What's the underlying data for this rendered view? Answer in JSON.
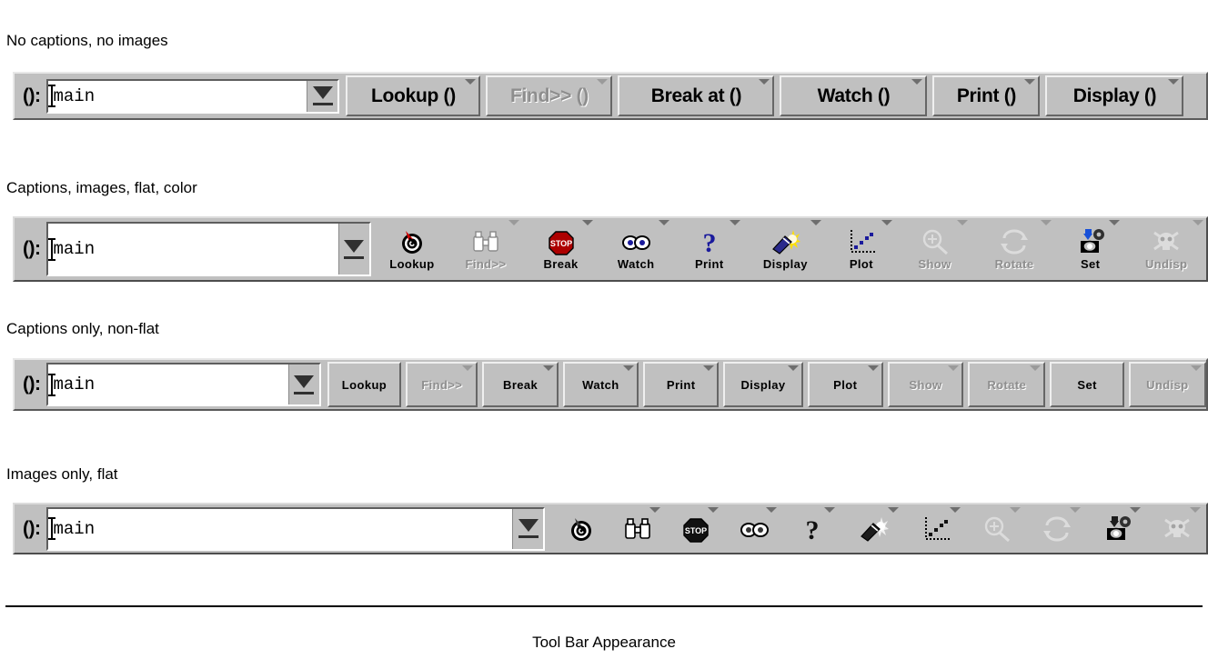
{
  "figure_caption": "Tool Bar Appearance",
  "combo": {
    "prompt": "():",
    "value": "main",
    "placeholder": "main",
    "arrow_icon": "chevron-down-icon"
  },
  "sections": [
    {
      "id": "no-captions-no-images",
      "label": "No captions, no images",
      "style": {
        "captions": true,
        "images": false,
        "flat": false,
        "color": false,
        "large_text": true
      },
      "buttons": [
        {
          "label": "Lookup ()",
          "icon": "target-icon",
          "enabled": true,
          "dropdown": true
        },
        {
          "label": "Find>> ()",
          "icon": "binoculars-icon",
          "enabled": false,
          "dropdown": true
        },
        {
          "label": "Break at ()",
          "icon": "stop-sign-icon",
          "enabled": true,
          "dropdown": true
        },
        {
          "label": "Watch ()",
          "icon": "eyes-icon",
          "enabled": true,
          "dropdown": true
        },
        {
          "label": "Print ()",
          "icon": "question-icon",
          "enabled": true,
          "dropdown": true
        },
        {
          "label": "Display ()",
          "icon": "flashlight-icon",
          "enabled": true,
          "dropdown": true
        }
      ]
    },
    {
      "id": "captions-images-flat-color",
      "label": "Captions, images, flat, color",
      "style": {
        "captions": true,
        "images": true,
        "flat": true,
        "color": true
      },
      "buttons": [
        {
          "label": "Lookup",
          "icon": "target-icon",
          "enabled": true,
          "dropdown": false
        },
        {
          "label": "Find>>",
          "icon": "binoculars-icon",
          "enabled": false,
          "dropdown": true
        },
        {
          "label": "Break",
          "icon": "stop-sign-icon",
          "enabled": true,
          "dropdown": true
        },
        {
          "label": "Watch",
          "icon": "eyes-icon",
          "enabled": true,
          "dropdown": true
        },
        {
          "label": "Print",
          "icon": "question-icon",
          "enabled": true,
          "dropdown": true
        },
        {
          "label": "Display",
          "icon": "flashlight-icon",
          "enabled": true,
          "dropdown": true
        },
        {
          "label": "Plot",
          "icon": "scatter-plot-icon",
          "enabled": true,
          "dropdown": true
        },
        {
          "label": "Show",
          "icon": "magnifier-icon",
          "enabled": false,
          "dropdown": true
        },
        {
          "label": "Rotate",
          "icon": "rotate-icon",
          "enabled": false,
          "dropdown": true
        },
        {
          "label": "Set",
          "icon": "gears-icon",
          "enabled": true,
          "dropdown": true
        },
        {
          "label": "Undisp",
          "icon": "skull-icon",
          "enabled": false,
          "dropdown": true
        }
      ]
    },
    {
      "id": "captions-only-non-flat",
      "label": "Captions only, non-flat",
      "style": {
        "captions": true,
        "images": false,
        "flat": false,
        "color": false
      },
      "buttons": [
        {
          "label": "Lookup",
          "icon": "target-icon",
          "enabled": true,
          "dropdown": false
        },
        {
          "label": "Find>>",
          "icon": "binoculars-icon",
          "enabled": false,
          "dropdown": true
        },
        {
          "label": "Break",
          "icon": "stop-sign-icon",
          "enabled": true,
          "dropdown": true
        },
        {
          "label": "Watch",
          "icon": "eyes-icon",
          "enabled": true,
          "dropdown": true
        },
        {
          "label": "Print",
          "icon": "question-icon",
          "enabled": true,
          "dropdown": true
        },
        {
          "label": "Display",
          "icon": "flashlight-icon",
          "enabled": true,
          "dropdown": true
        },
        {
          "label": "Plot",
          "icon": "scatter-plot-icon",
          "enabled": true,
          "dropdown": true
        },
        {
          "label": "Show",
          "icon": "magnifier-icon",
          "enabled": false,
          "dropdown": true
        },
        {
          "label": "Rotate",
          "icon": "rotate-icon",
          "enabled": false,
          "dropdown": true
        },
        {
          "label": "Set",
          "icon": "gears-icon",
          "enabled": true,
          "dropdown": false
        },
        {
          "label": "Undisp",
          "icon": "skull-icon",
          "enabled": false,
          "dropdown": true
        }
      ]
    },
    {
      "id": "images-only-flat",
      "label": "Images only, flat",
      "style": {
        "captions": false,
        "images": true,
        "flat": true,
        "color": false
      },
      "buttons": [
        {
          "label": "Lookup",
          "icon": "target-icon",
          "enabled": true,
          "dropdown": false
        },
        {
          "label": "Find>>",
          "icon": "binoculars-icon",
          "enabled": true,
          "dropdown": true
        },
        {
          "label": "Break",
          "icon": "stop-sign-icon",
          "enabled": true,
          "dropdown": true
        },
        {
          "label": "Watch",
          "icon": "eyes-icon",
          "enabled": true,
          "dropdown": true
        },
        {
          "label": "Print",
          "icon": "question-icon",
          "enabled": true,
          "dropdown": true
        },
        {
          "label": "Display",
          "icon": "flashlight-icon",
          "enabled": true,
          "dropdown": true
        },
        {
          "label": "Plot",
          "icon": "scatter-plot-icon",
          "enabled": true,
          "dropdown": true
        },
        {
          "label": "Show",
          "icon": "magnifier-icon",
          "enabled": false,
          "dropdown": true
        },
        {
          "label": "Rotate",
          "icon": "rotate-icon",
          "enabled": false,
          "dropdown": true
        },
        {
          "label": "Set",
          "icon": "gears-icon",
          "enabled": true,
          "dropdown": true
        },
        {
          "label": "Undisp",
          "icon": "skull-icon",
          "enabled": false,
          "dropdown": true
        }
      ]
    }
  ],
  "colors": {
    "toolbar_face": "#c0c0c0",
    "page_background": "#ffffff",
    "text": "#000000",
    "disabled_text": "#8e8e8e",
    "accent_red": "#c00000",
    "accent_blue": "#1a1a9c",
    "accent_yellow": "#ffe000"
  }
}
